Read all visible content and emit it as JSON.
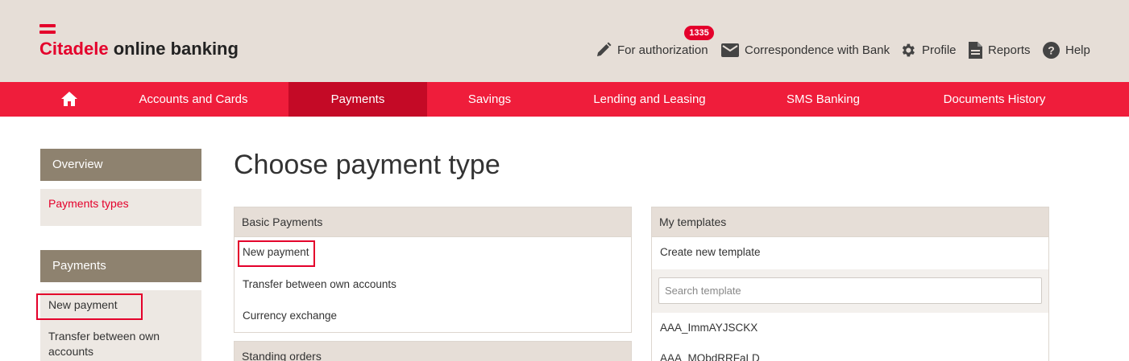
{
  "header": {
    "logo_brand": "Citadele",
    "logo_rest": " online banking",
    "badge_count": "1335",
    "links": {
      "authorization": "For authorization",
      "correspondence": "Correspondence with Bank",
      "profile": "Profile",
      "reports": "Reports",
      "help": "Help"
    }
  },
  "mainnav": {
    "items": [
      "Accounts and Cards",
      "Payments",
      "Savings",
      "Lending and Leasing",
      "SMS Banking",
      "Documents History"
    ],
    "active": "Payments"
  },
  "sidebar": {
    "overview_title": "Overview",
    "overview_link": "Payments types",
    "payments_title": "Payments",
    "payments_links": [
      "New payment",
      "Transfer between own",
      "accounts"
    ]
  },
  "main": {
    "title": "Choose payment type",
    "basic": {
      "title": "Basic Payments",
      "links": [
        "New payment",
        "Transfer between own accounts",
        "Currency exchange"
      ]
    },
    "standing": {
      "title": "Standing orders"
    },
    "templates": {
      "title": "My templates",
      "create": "Create new template",
      "search_placeholder": "Search template",
      "items": [
        "AAA_ImmAYJSCKX",
        "AAA_MQbdRRFaLD"
      ]
    }
  },
  "colors": {
    "brand_red": "#e4002b",
    "nav_red": "#ef1d3b",
    "nav_active": "#c40a26",
    "header_bg": "#e6ded7",
    "sidebar_head": "#8e826f"
  },
  "icons": [
    "pencil-icon",
    "envelope-icon",
    "gear-icon",
    "document-icon",
    "help-icon",
    "home-icon"
  ]
}
